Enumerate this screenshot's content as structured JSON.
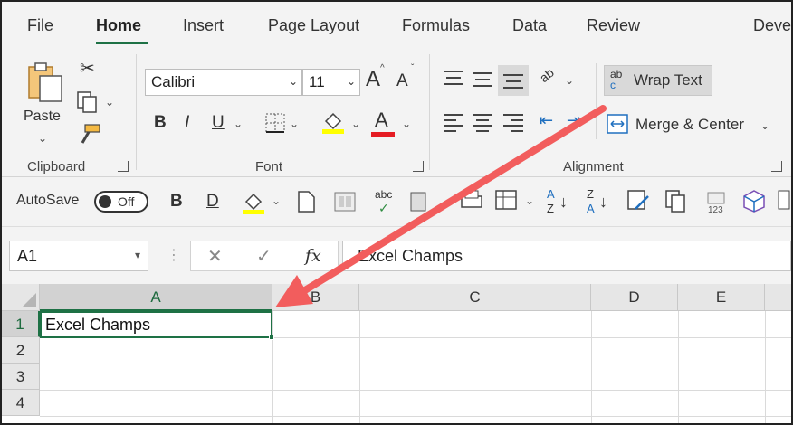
{
  "tabs": [
    "File",
    "Home",
    "Insert",
    "Page Layout",
    "Formulas",
    "Data",
    "Review",
    "Deve"
  ],
  "ribbon": {
    "clipboard": {
      "paste_label": "Paste",
      "group_label": "Clipboard"
    },
    "font": {
      "font_name": "Calibri",
      "font_size": "11",
      "group_label": "Font",
      "bold": "B",
      "italic": "I",
      "underline": "U",
      "grow": "A",
      "shrink": "A",
      "color_letter": "A"
    },
    "alignment": {
      "wrap_text": "Wrap Text",
      "merge_center": "Merge & Center",
      "group_label": "Alignment",
      "wrap_icon_top": "ab",
      "wrap_icon_bottom": "c",
      "orient_icon": "ab"
    }
  },
  "qat": {
    "autosave_label": "AutoSave",
    "toggle_state": "Off",
    "bold": "B",
    "double_underline": "D",
    "spell_icon": "abc",
    "sort_az_top": "A",
    "sort_az_bottom": "Z",
    "sort_za_top": "Z",
    "sort_za_bottom": "A",
    "number_icon": "123"
  },
  "formula_bar": {
    "name_box": "A1",
    "cancel_icon": "✕",
    "enter_icon": "✓",
    "fx_label": "fx",
    "formula_value": "Excel Champs"
  },
  "grid": {
    "columns": [
      "A",
      "B",
      "C",
      "D",
      "E"
    ],
    "rows": [
      "1",
      "2",
      "3",
      "4"
    ],
    "active_cell_value": "Excel Champs"
  },
  "colors": {
    "accent": "#1e7145",
    "arrow": "#f25d5d",
    "highlight_yellow": "#ffff00",
    "font_red": "#e51c23"
  }
}
